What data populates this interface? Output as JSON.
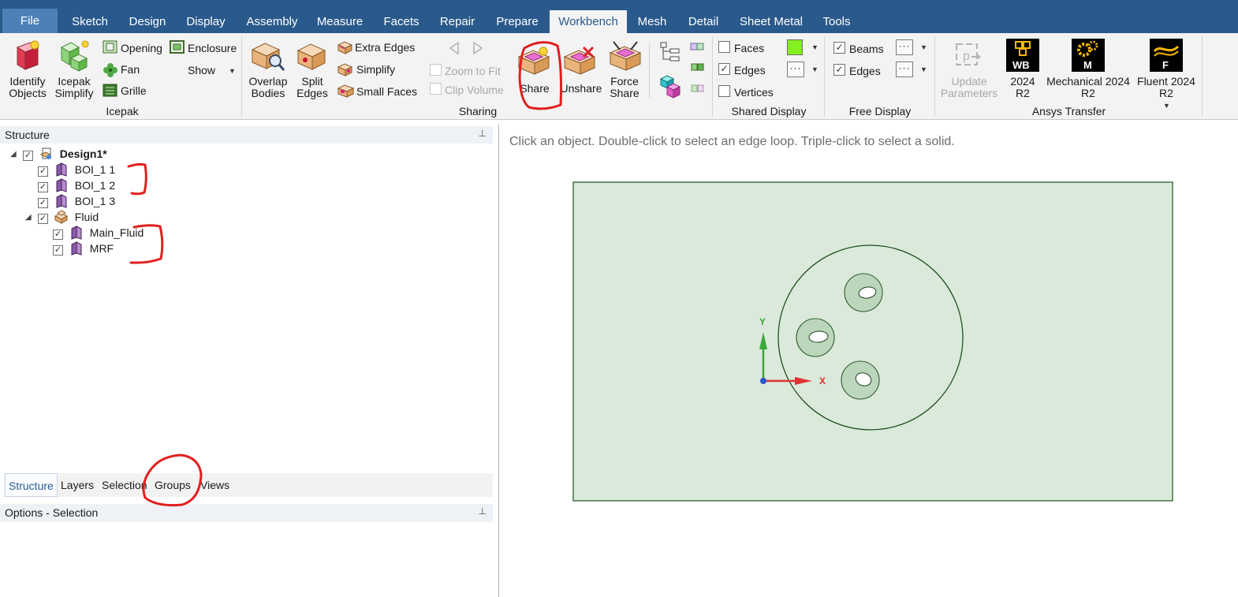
{
  "menu": {
    "tabs": [
      "File",
      "Sketch",
      "Design",
      "Display",
      "Assembly",
      "Measure",
      "Facets",
      "Repair",
      "Prepare",
      "Workbench",
      "Mesh",
      "Detail",
      "Sheet Metal",
      "Tools"
    ],
    "active": "Workbench"
  },
  "ribbon": {
    "icepak": {
      "identify_objects": "Identify\nObjects",
      "icepak_simplify": "Icepak\nSimplify",
      "opening": "Opening",
      "fan": "Fan",
      "grille": "Grille",
      "enclosure": "Enclosure",
      "show": "Show",
      "label": "Icepak"
    },
    "sharing": {
      "overlap_bodies": "Overlap\nBodies",
      "split_edges": "Split\nEdges",
      "extra_edges": "Extra Edges",
      "simplify": "Simplify",
      "small_faces": "Small Faces",
      "zoom_to_fit": "Zoom to Fit",
      "clip_volume": "Clip Volume",
      "share": "Share",
      "unshare": "Unshare",
      "force_share": "Force\nShare",
      "label": "Sharing"
    },
    "shared_display": {
      "faces": "Faces",
      "edges": "Edges",
      "vertices": "Vertices",
      "faces_checked": false,
      "edges_checked": true,
      "vertices_checked": false,
      "color": "#84f01e",
      "label": "Shared Display"
    },
    "free_display": {
      "beams": "Beams",
      "edges": "Edges",
      "beams_checked": true,
      "edges_checked": true,
      "label": "Free Display"
    },
    "ansys_transfer": {
      "update_parameters": "Update\nParameters",
      "wb": "2024\nR2",
      "wb_badge": "WB",
      "mechanical": "Mechanical 2024\nR2",
      "mechanical_badge": "M",
      "fluent": "Fluent 2024\nR2",
      "fluent_badge": "F",
      "label": "Ansys Transfer"
    }
  },
  "structure": {
    "title": "Structure",
    "root": "Design1*",
    "items": [
      {
        "label": "BOI_1 1"
      },
      {
        "label": "BOI_1 2"
      },
      {
        "label": "BOI_1 3"
      },
      {
        "label": "Fluid"
      },
      {
        "label": "Main_Fluid"
      },
      {
        "label": "MRF"
      }
    ]
  },
  "bottom_tabs": [
    "Structure",
    "Layers",
    "Selection",
    "Groups",
    "Views"
  ],
  "options": {
    "title": "Options - Selection"
  },
  "viewport": {
    "hint": "Click an object. Double-click to select an edge loop. Triple-click to select a solid.",
    "axis_x": "X",
    "axis_y": "Y"
  }
}
